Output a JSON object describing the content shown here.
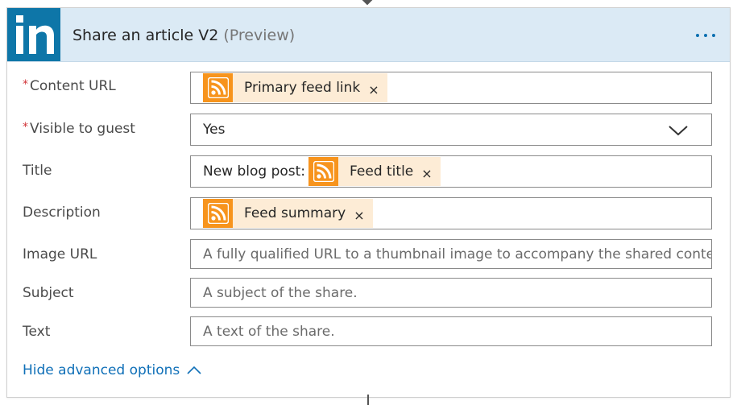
{
  "action": {
    "title": "Share an article V2",
    "preview_label": "(Preview)",
    "icon": "linkedin-logo",
    "brand_color": "#0e76a8",
    "header_bg": "#dbeaf5"
  },
  "fields": {
    "content_url": {
      "label": "Content URL",
      "required_marker": "*",
      "token": {
        "label": "Primary feed link",
        "icon": "rss-icon",
        "remove": "×"
      }
    },
    "visible_to_guest": {
      "label": "Visible to guest",
      "required_marker": "*",
      "value": "Yes"
    },
    "title": {
      "label": "Title",
      "prefix": "New blog post:",
      "token": {
        "label": "Feed title",
        "icon": "rss-icon",
        "remove": "×"
      }
    },
    "description": {
      "label": "Description",
      "token": {
        "label": "Feed summary",
        "icon": "rss-icon",
        "remove": "×"
      }
    },
    "image_url": {
      "label": "Image URL",
      "placeholder": "A fully qualified URL to a thumbnail image to accompany the shared content."
    },
    "subject": {
      "label": "Subject",
      "placeholder": "A subject of the share."
    },
    "text": {
      "label": "Text",
      "placeholder": "A text of the share."
    }
  },
  "advanced": {
    "label": "Hide advanced options",
    "icon": "chevron-up-icon"
  },
  "colors": {
    "token_icon_bg": "#f7941d",
    "token_bg": "#fdecd6",
    "link": "#1070b8",
    "required": "#d13438"
  }
}
